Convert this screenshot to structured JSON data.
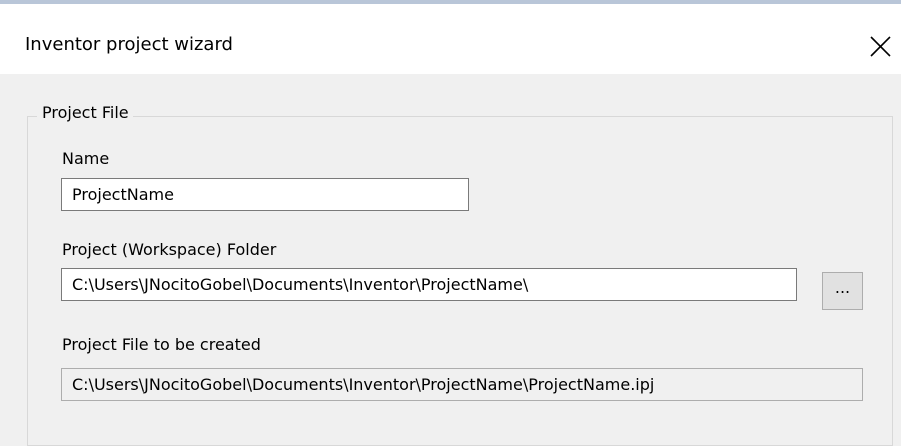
{
  "window": {
    "title": "Inventor project wizard",
    "close_icon": "close-icon"
  },
  "project_file_group": {
    "legend": "Project File",
    "name": {
      "label": "Name",
      "value": "ProjectName"
    },
    "workspace_folder": {
      "label": "Project (Workspace) Folder",
      "value": "C:\\Users\\JNocitoGobel\\Documents\\Inventor\\ProjectName\\",
      "browse_label": "..."
    },
    "file_to_create": {
      "label": "Project File to be created",
      "value": "C:\\Users\\JNocitoGobel\\Documents\\Inventor\\ProjectName\\ProjectName.ipj"
    }
  },
  "colors": {
    "dialog_background": "#f0f0f0",
    "titlebar_background": "#ffffff",
    "input_border": "#7a7a7a",
    "group_border": "#d8d8d8"
  }
}
